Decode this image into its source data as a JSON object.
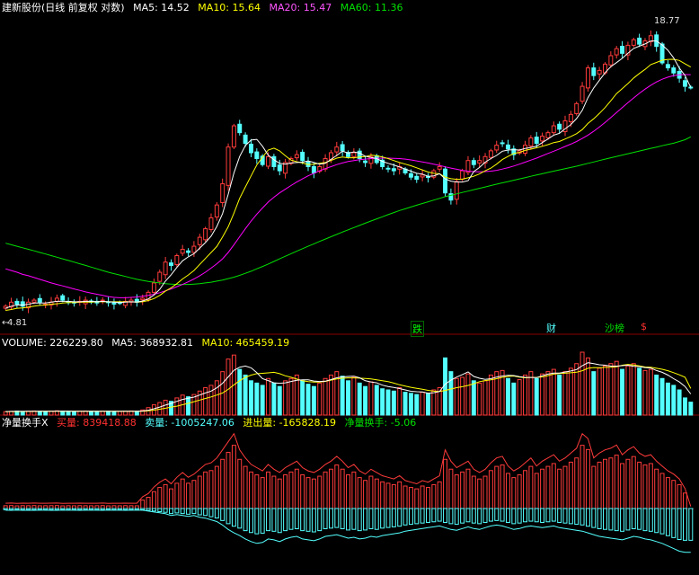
{
  "main_panel": {
    "title": "建新股份(日线 前复权 对数)",
    "ma5": "MA5: 14.52",
    "ma10": "MA10: 15.64",
    "ma20": "MA20: 15.47",
    "ma60": "MA60: 11.36",
    "high_label": "18.77",
    "low_label": "4.81",
    "event_tags": [
      "跌",
      "财",
      "沙榜",
      "$"
    ]
  },
  "volume_panel": {
    "title": "VOLUME: 226229.80",
    "ma5": "MA5: 368932.81",
    "ma10": "MA10: 465459.19"
  },
  "flow_panel": {
    "title": "净量换手X",
    "buy": "买量: 839418.88",
    "sell": "卖量: -1005247.06",
    "net_in": "进出量: -165828.19",
    "net_turnover": "净量换手: -5.06"
  },
  "colors": {
    "up": "#ff3b3b",
    "down": "#54ffff",
    "ma5": "#ffffff",
    "ma10": "#ffff00",
    "ma20": "#ff00ff",
    "ma60": "#00e000",
    "label": "#c0c0c0"
  },
  "chart_data": [
    {
      "type": "candlestick",
      "panel": "price",
      "scale": "log",
      "ylim": [
        4.6,
        20.5
      ],
      "series_names": [
        "MA5",
        "MA10",
        "MA20",
        "MA60"
      ],
      "closes": [
        4.9,
        5.0,
        4.95,
        4.9,
        5.0,
        5.05,
        5.0,
        4.95,
        5.0,
        5.1,
        5.05,
        5.0,
        4.98,
        5.02,
        5.05,
        5.0,
        4.98,
        5.05,
        5.0,
        4.95,
        4.98,
        5.02,
        5.05,
        5.0,
        5.1,
        5.25,
        5.5,
        5.8,
        6.1,
        6.0,
        6.3,
        6.5,
        6.4,
        6.6,
        6.9,
        7.2,
        7.6,
        8.1,
        9.0,
        10.8,
        12.0,
        11.6,
        11.0,
        10.5,
        10.2,
        9.9,
        10.3,
        9.8,
        9.6,
        10.0,
        10.2,
        10.4,
        10.1,
        9.8,
        9.5,
        9.8,
        10.2,
        10.5,
        10.8,
        10.6,
        10.3,
        10.5,
        10.2,
        10.0,
        10.3,
        10.0,
        9.8,
        9.7,
        9.6,
        9.8,
        9.5,
        9.3,
        9.2,
        9.4,
        9.3,
        9.6,
        9.8,
        8.6,
        8.3,
        9.1,
        9.6,
        10.1,
        9.9,
        10.1,
        10.3,
        10.6,
        10.9,
        11.0,
        10.7,
        10.4,
        10.6,
        10.9,
        11.3,
        11.0,
        11.4,
        11.6,
        12.0,
        11.8,
        12.3,
        12.7,
        13.4,
        14.6,
        16.0,
        15.4,
        15.8,
        16.3,
        17.0,
        17.6,
        17.2,
        17.9,
        18.4,
        18.0,
        18.3,
        18.77,
        17.8,
        16.4,
        16.0,
        15.6,
        15.2,
        14.6,
        14.52
      ],
      "ma5": [
        4.85,
        4.9,
        4.93,
        4.93,
        4.95,
        4.98,
        4.98,
        4.98,
        5.0,
        5.02,
        5.02,
        5.02,
        5.01,
        5.01,
        5.02,
        5.02,
        5.01,
        5.02,
        5.01,
        5.0,
        4.99,
        5.0,
        5.01,
        5.0,
        5.03,
        5.08,
        5.18,
        5.33,
        5.55,
        5.73,
        5.94,
        6.14,
        6.26,
        6.36,
        6.54,
        6.72,
        6.94,
        7.28,
        7.76,
        8.54,
        9.5,
        10.3,
        10.88,
        11.18,
        11.22,
        10.84,
        10.38,
        10.14,
        9.96,
        9.92,
        9.98,
        10.0,
        10.02,
        10.08,
        10.0,
        9.92,
        9.96,
        10.16,
        10.36,
        10.58,
        10.48,
        10.54,
        10.48,
        10.32,
        10.26,
        10.2,
        10.06,
        9.96,
        9.88,
        9.78,
        9.68,
        9.58,
        9.48,
        9.44,
        9.34,
        9.36,
        9.46,
        9.22,
        9.12,
        9.08,
        9.08,
        9.14,
        9.56,
        9.76,
        10.02,
        10.2,
        10.36,
        10.58,
        10.64,
        10.66,
        10.64,
        10.72,
        10.78,
        10.84,
        11.04,
        11.24,
        11.46,
        11.56,
        11.82,
        12.08,
        12.44,
        12.96,
        13.8,
        14.48,
        15.04,
        15.62,
        16.1,
        16.42,
        16.78,
        17.2,
        17.62,
        17.82,
        18.02,
        18.29,
        18.29,
        17.93,
        17.46,
        16.82,
        15.99,
        15.4,
        14.52
      ],
      "ma10": [
        4.8,
        4.82,
        4.85,
        4.86,
        4.88,
        4.9,
        4.92,
        4.93,
        4.95,
        4.96,
        4.98,
        4.99,
        4.99,
        5.0,
        5.0,
        5.0,
        5.01,
        5.01,
        5.01,
        5.01,
        5.01,
        5.01,
        5.01,
        5.0,
        5.01,
        5.04,
        5.09,
        5.17,
        5.28,
        5.37,
        5.48,
        5.61,
        5.72,
        5.85,
        6.03,
        6.21,
        6.4,
        6.59,
        6.91,
        7.27,
        7.78,
        8.37,
        8.86,
        9.36,
        9.88,
        10.27,
        10.64,
        10.74,
        10.6,
        10.34,
        10.12,
        10.04,
        9.98,
        9.9,
        9.92,
        9.96,
        10.0,
        10.1,
        10.22,
        10.28,
        10.24,
        10.24,
        10.28,
        10.3,
        10.38,
        10.34,
        10.28,
        10.2,
        10.1,
        10.0,
        9.92,
        9.84,
        9.74,
        9.64,
        9.54,
        9.48,
        9.46,
        9.3,
        9.23,
        9.2,
        9.21,
        9.27,
        9.34,
        9.45,
        9.6,
        9.73,
        9.92,
        10.15,
        10.31,
        10.46,
        10.52,
        10.62,
        10.69,
        10.76,
        10.84,
        10.93,
        11.04,
        11.1,
        11.24,
        11.38,
        11.54,
        11.78,
        12.14,
        12.43,
        12.76,
        13.14,
        13.59,
        14.08,
        14.44,
        14.8,
        15.22,
        15.56,
        15.88,
        16.26,
        16.44,
        16.62,
        16.69,
        16.7,
        16.6,
        16.32,
        16.07
      ],
      "ma20": [
        5.9,
        5.85,
        5.8,
        5.74,
        5.7,
        5.65,
        5.6,
        5.55,
        5.5,
        5.46,
        5.42,
        5.38,
        5.34,
        5.3,
        5.26,
        5.23,
        5.2,
        5.17,
        5.14,
        5.12,
        5.11,
        5.11,
        5.12,
        5.13,
        5.15,
        5.17,
        5.2,
        5.24,
        5.29,
        5.34,
        5.4,
        5.46,
        5.53,
        5.61,
        5.7,
        5.8,
        5.92,
        6.05,
        6.2,
        6.4,
        6.65,
        6.92,
        7.2,
        7.48,
        7.74,
        7.98,
        8.22,
        8.42,
        8.6,
        8.76,
        8.92,
        9.08,
        9.22,
        9.36,
        9.48,
        9.6,
        9.7,
        9.8,
        9.9,
        9.98,
        10.05,
        10.1,
        10.14,
        10.17,
        10.2,
        10.21,
        10.22,
        10.22,
        10.21,
        10.2,
        10.17,
        10.13,
        10.08,
        10.03,
        9.98,
        9.92,
        9.86,
        9.79,
        9.73,
        9.67,
        9.62,
        9.58,
        9.56,
        9.55,
        9.56,
        9.58,
        9.62,
        9.68,
        9.75,
        9.83,
        9.92,
        10.02,
        10.12,
        10.22,
        10.34,
        10.46,
        10.58,
        10.7,
        10.83,
        10.96,
        11.1,
        11.27,
        11.46,
        11.68,
        11.93,
        12.2,
        12.5,
        12.82,
        13.14,
        13.46,
        13.78,
        14.1,
        14.4,
        14.68,
        14.92,
        15.12,
        15.28,
        15.4,
        15.46,
        15.48,
        15.47
      ],
      "ma60": [
        6.7,
        6.65,
        6.6,
        6.55,
        6.5,
        6.45,
        6.4,
        6.35,
        6.3,
        6.25,
        6.2,
        6.15,
        6.1,
        6.05,
        6.0,
        5.95,
        5.9,
        5.85,
        5.8,
        5.76,
        5.72,
        5.68,
        5.64,
        5.6,
        5.57,
        5.54,
        5.52,
        5.5,
        5.48,
        5.47,
        5.46,
        5.46,
        5.46,
        5.47,
        5.48,
        5.5,
        5.52,
        5.55,
        5.58,
        5.62,
        5.66,
        5.71,
        5.77,
        5.83,
        5.9,
        5.97,
        6.04,
        6.12,
        6.2,
        6.28,
        6.36,
        6.44,
        6.52,
        6.6,
        6.68,
        6.76,
        6.84,
        6.92,
        7.0,
        7.08,
        7.16,
        7.24,
        7.32,
        7.4,
        7.48,
        7.56,
        7.64,
        7.72,
        7.8,
        7.88,
        7.95,
        8.02,
        8.09,
        8.16,
        8.23,
        8.3,
        8.37,
        8.44,
        8.5,
        8.56,
        8.62,
        8.68,
        8.74,
        8.8,
        8.86,
        8.92,
        8.98,
        9.04,
        9.1,
        9.16,
        9.22,
        9.28,
        9.34,
        9.4,
        9.46,
        9.52,
        9.58,
        9.64,
        9.7,
        9.76,
        9.82,
        9.89,
        9.96,
        10.03,
        10.1,
        10.17,
        10.24,
        10.31,
        10.38,
        10.45,
        10.52,
        10.59,
        10.66,
        10.73,
        10.8,
        10.87,
        10.94,
        11.01,
        11.1,
        11.2,
        11.36
      ]
    },
    {
      "type": "bar",
      "panel": "volume",
      "ylim": [
        0,
        1100000
      ],
      "values": [
        60000,
        65000,
        70000,
        62000,
        68000,
        72000,
        66000,
        64000,
        70000,
        75000,
        68000,
        66000,
        62000,
        70000,
        72000,
        66000,
        64000,
        70000,
        68000,
        62000,
        64000,
        70000,
        72000,
        66000,
        90000,
        130000,
        180000,
        220000,
        260000,
        240000,
        300000,
        350000,
        320000,
        360000,
        420000,
        480000,
        520000,
        600000,
        760000,
        980000,
        1050000,
        800000,
        700000,
        600000,
        560000,
        520000,
        640000,
        560000,
        500000,
        600000,
        640000,
        700000,
        600000,
        540000,
        500000,
        560000,
        640000,
        700000,
        760000,
        680000,
        600000,
        660000,
        560000,
        500000,
        580000,
        520000,
        460000,
        440000,
        420000,
        480000,
        400000,
        380000,
        360000,
        400000,
        380000,
        440000,
        480000,
        1000000,
        760000,
        640000,
        660000,
        720000,
        600000,
        560000,
        600000,
        700000,
        760000,
        780000,
        640000,
        560000,
        620000,
        700000,
        760000,
        640000,
        720000,
        760000,
        800000,
        700000,
        760000,
        820000,
        900000,
        1100000,
        1000000,
        760000,
        820000,
        860000,
        900000,
        940000,
        800000,
        860000,
        900000,
        820000,
        780000,
        800000,
        700000,
        640000,
        560000,
        520000,
        440000,
        300000,
        226229
      ],
      "ma5": [
        62000,
        64000,
        66000,
        66000,
        67000,
        68000,
        67000,
        67000,
        68000,
        69000,
        69000,
        69000,
        68000,
        68000,
        68000,
        67000,
        67000,
        68000,
        68000,
        67000,
        66000,
        66000,
        67000,
        67000,
        72000,
        85000,
        110000,
        140000,
        174000,
        204000,
        240000,
        274000,
        294000,
        314000,
        350000,
        386000,
        420000,
        476000,
        556000,
        668000,
        782000,
        838000,
        858000,
        826000,
        742000,
        636000,
        604000,
        564000,
        556000,
        564000,
        588000,
        608000,
        616000,
        616000,
        596000,
        588000,
        592000,
        620000,
        652000,
        668000,
        676000,
        680000,
        652000,
        600000,
        580000,
        564000,
        524000,
        500000,
        484000,
        464000,
        440000,
        416000,
        408000,
        404000,
        384000,
        392000,
        412000,
        540000,
        612000,
        664000,
        708000,
        756000,
        676000,
        644000,
        626000,
        636000,
        664000,
        684000,
        696000,
        692000,
        672000,
        660000,
        658000,
        656000,
        688000,
        716000,
        736000,
        736000,
        752000,
        772000,
        796000,
        864000,
        916000,
        900000,
        880000,
        872000,
        856000,
        856000,
        864000,
        872000,
        852000,
        848000,
        832000,
        824000,
        780000,
        748000,
        700000,
        636000,
        580000,
        500000,
        368932
      ],
      "ma10": [
        60000,
        61000,
        62000,
        63000,
        64000,
        65000,
        66000,
        66000,
        67000,
        67000,
        67000,
        67000,
        67000,
        67000,
        67000,
        67000,
        67000,
        67000,
        67000,
        67000,
        67000,
        67000,
        67000,
        67000,
        68000,
        74000,
        86000,
        102000,
        120000,
        140000,
        156000,
        180000,
        206000,
        234000,
        262000,
        290000,
        318000,
        350000,
        386000,
        450000,
        530000,
        600000,
        660000,
        700000,
        724000,
        730000,
        738000,
        748000,
        724000,
        686000,
        662000,
        630000,
        602000,
        586000,
        576000,
        576000,
        590000,
        612000,
        632000,
        644000,
        650000,
        650000,
        646000,
        640000,
        634000,
        616000,
        600000,
        584000,
        560000,
        530000,
        508000,
        486000,
        468000,
        452000,
        432000,
        418000,
        412000,
        430000,
        456000,
        480000,
        496000,
        518000,
        548000,
        584000,
        604000,
        616000,
        636000,
        660000,
        676000,
        684000,
        664000,
        652000,
        658000,
        660000,
        668000,
        690000,
        716000,
        726000,
        732000,
        740000,
        750000,
        776000,
        818000,
        832000,
        830000,
        834000,
        836000,
        846000,
        872000,
        886000,
        876000,
        860000,
        840000,
        836000,
        818000,
        802000,
        776000,
        742000,
        704000,
        662000,
        465459
      ]
    },
    {
      "type": "bar",
      "panel": "net-flow",
      "series_names": [
        "买量",
        "卖量"
      ],
      "buy": [
        40000,
        42000,
        38000,
        41000,
        40000,
        42000,
        39000,
        40000,
        41000,
        42000,
        38000,
        40000,
        39000,
        41000,
        40000,
        39000,
        40000,
        42000,
        38000,
        40000,
        39000,
        41000,
        40000,
        39000,
        120000,
        160000,
        240000,
        300000,
        340000,
        280000,
        360000,
        420000,
        360000,
        400000,
        460000,
        520000,
        540000,
        600000,
        700000,
        800000,
        900000,
        700000,
        600000,
        520000,
        480000,
        440000,
        520000,
        460000,
        420000,
        480000,
        520000,
        560000,
        480000,
        440000,
        420000,
        460000,
        520000,
        560000,
        620000,
        560000,
        480000,
        520000,
        440000,
        400000,
        460000,
        420000,
        380000,
        360000,
        340000,
        380000,
        320000,
        300000,
        280000,
        320000,
        300000,
        340000,
        380000,
        700000,
        560000,
        480000,
        520000,
        560000,
        460000,
        420000,
        460000,
        540000,
        600000,
        620000,
        500000,
        440000,
        480000,
        540000,
        600000,
        500000,
        560000,
        600000,
        640000,
        560000,
        600000,
        660000,
        720000,
        900000,
        840000,
        600000,
        660000,
        700000,
        720000,
        760000,
        640000,
        700000,
        740000,
        660000,
        620000,
        640000,
        560000,
        500000,
        440000,
        400000,
        340000,
        220000,
        0
      ],
      "sell": [
        -40000,
        -42000,
        -38000,
        -41000,
        -40000,
        -42000,
        -39000,
        -40000,
        -41000,
        -42000,
        -38000,
        -40000,
        -39000,
        -41000,
        -40000,
        -39000,
        -40000,
        -42000,
        -38000,
        -40000,
        -39000,
        -41000,
        -40000,
        -39000,
        -40000,
        -60000,
        -80000,
        -100000,
        -120000,
        -160000,
        -140000,
        -160000,
        -180000,
        -160000,
        -200000,
        -220000,
        -260000,
        -300000,
        -380000,
        -480000,
        -560000,
        -620000,
        -700000,
        -760000,
        -800000,
        -780000,
        -700000,
        -720000,
        -760000,
        -700000,
        -660000,
        -640000,
        -700000,
        -720000,
        -740000,
        -700000,
        -640000,
        -620000,
        -600000,
        -640000,
        -680000,
        -660000,
        -700000,
        -680000,
        -640000,
        -660000,
        -620000,
        -600000,
        -580000,
        -560000,
        -520000,
        -500000,
        -480000,
        -460000,
        -440000,
        -420000,
        -400000,
        -440000,
        -480000,
        -500000,
        -460000,
        -420000,
        -460000,
        -480000,
        -440000,
        -400000,
        -380000,
        -400000,
        -440000,
        -480000,
        -460000,
        -420000,
        -400000,
        -420000,
        -440000,
        -420000,
        -400000,
        -440000,
        -460000,
        -480000,
        -500000,
        -520000,
        -560000,
        -600000,
        -640000,
        -660000,
        -680000,
        -700000,
        -720000,
        -680000,
        -640000,
        -660000,
        -700000,
        -720000,
        -760000,
        -800000,
        -860000,
        -920000,
        -980000,
        -1005247,
        -1005247
      ]
    }
  ]
}
